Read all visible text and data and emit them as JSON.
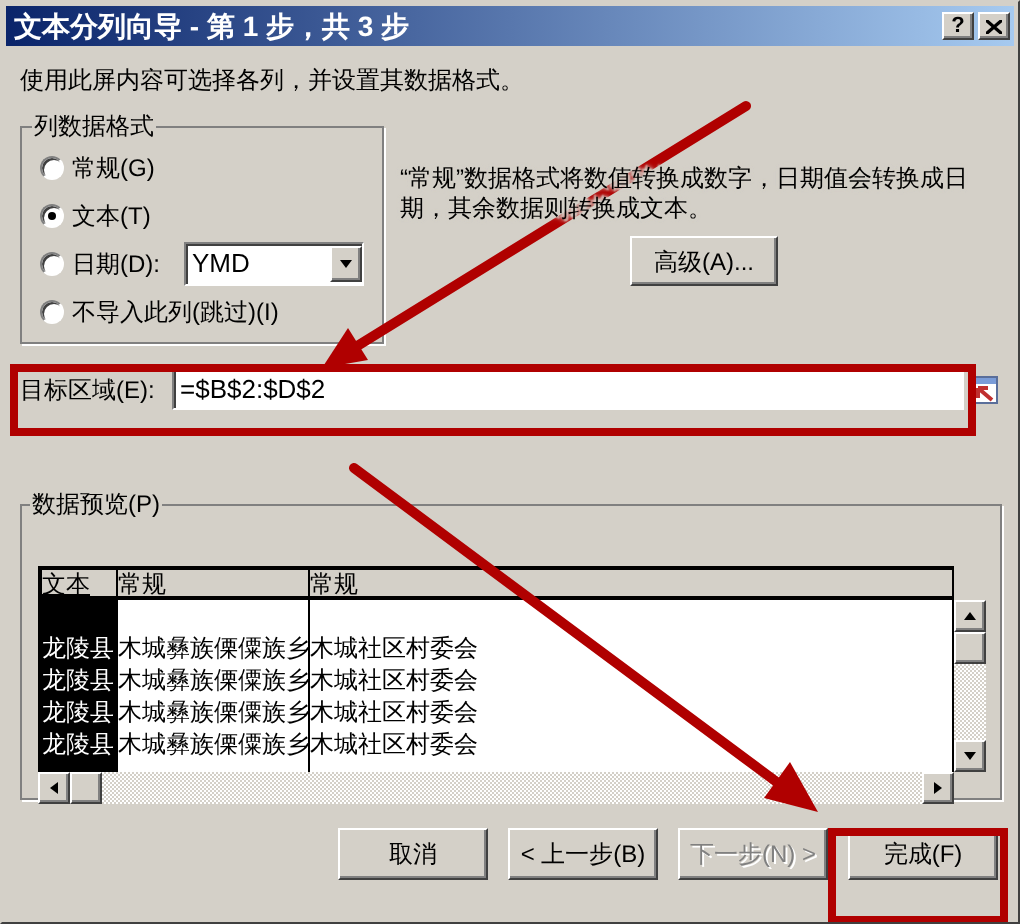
{
  "window": {
    "title": "文本分列向导 - 第 1 步，共 3 步",
    "help": "?"
  },
  "instruction": "使用此屏内容可选择各列，并设置其数据格式。",
  "format_group": {
    "label": "列数据格式",
    "options": [
      {
        "kind": "plain",
        "label": "常规(G)",
        "selected": false
      },
      {
        "kind": "plain",
        "label": "文本(T)",
        "selected": true
      },
      {
        "kind": "date",
        "label": "日期(D):",
        "selected": false,
        "value": "YMD"
      },
      {
        "kind": "plain",
        "label": "不导入此列(跳过)(I)",
        "selected": false
      }
    ]
  },
  "description": "“常规”数据格式将数值转换成数字，日期值会转换成日期，其余数据则转换成文本。",
  "advanced_button": "高级(A)...",
  "destination": {
    "label": "目标区域(E):",
    "value": "=$B$2:$D$2"
  },
  "preview": {
    "label": "数据预览(P)",
    "columns": [
      {
        "header": "文本",
        "selected": true
      },
      {
        "header": "常规",
        "selected": false
      },
      {
        "header": "常规",
        "selected": false
      }
    ],
    "rows": [
      [
        "龙陵县",
        "木城彝族傈僳族乡",
        "木城社区村委会"
      ],
      [
        "龙陵县",
        "木城彝族傈僳族乡",
        "木城社区村委会"
      ],
      [
        "龙陵县",
        "木城彝族傈僳族乡",
        "木城社区村委会"
      ],
      [
        "龙陵县",
        "木城彝族傈僳族乡",
        "木城社区村委会"
      ]
    ]
  },
  "buttons": [
    {
      "label": "取消",
      "disabled": false
    },
    {
      "label": "< 上一步(B)",
      "disabled": false
    },
    {
      "label": "下一步(N) >",
      "disabled": true
    },
    {
      "label": "完成(F)",
      "disabled": false
    }
  ]
}
